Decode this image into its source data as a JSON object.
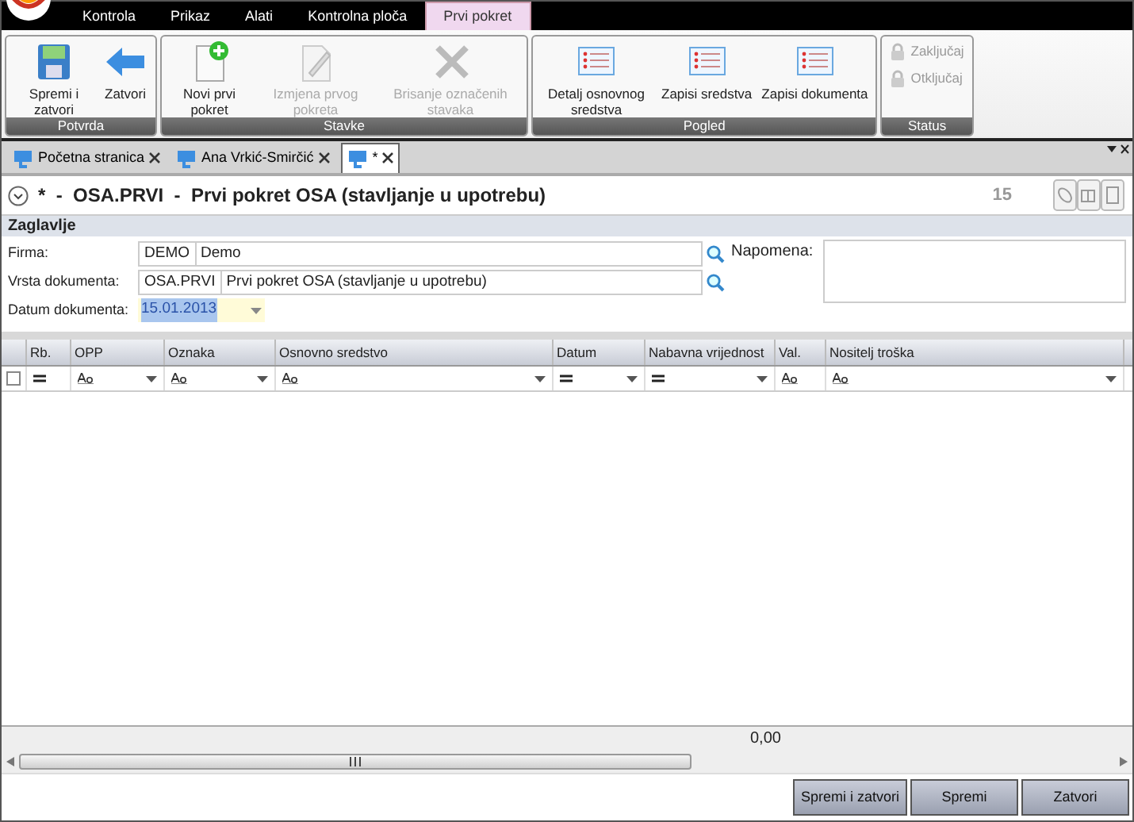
{
  "menu_tabs": [
    {
      "label": "Kontrola",
      "selected": false
    },
    {
      "label": "Prikaz",
      "selected": false
    },
    {
      "label": "Alati",
      "selected": false
    },
    {
      "label": "Kontrolna ploča",
      "selected": false
    },
    {
      "label": "Prvi pokret",
      "selected": true
    }
  ],
  "ribbon_groups": [
    {
      "title": "Potvrda",
      "kind": "large",
      "buttons": [
        {
          "label": "Spremi i zatvori",
          "kind": "save",
          "disabled": false
        },
        {
          "label": "Zatvori",
          "kind": "back",
          "disabled": false
        }
      ]
    },
    {
      "title": "Stavke",
      "kind": "large",
      "buttons": [
        {
          "label": "Novi prvi pokret",
          "kind": "new",
          "disabled": false
        },
        {
          "label": "Izmjena prvog pokreta",
          "kind": "edit",
          "disabled": true
        },
        {
          "label": "Brisanje označenih stavaka",
          "kind": "delete",
          "disabled": true
        }
      ]
    },
    {
      "title": "Pogled",
      "kind": "large",
      "buttons": [
        {
          "label": "Detalj osnovnog sredstva",
          "kind": "list",
          "disabled": false
        },
        {
          "label": "Zapisi sredstva",
          "kind": "list",
          "disabled": false
        },
        {
          "label": "Zapisi dokumenta",
          "kind": "list",
          "disabled": false
        }
      ]
    },
    {
      "title": "Status",
      "kind": "small",
      "buttons": [
        {
          "label": "Zaključaj",
          "kind": "lock",
          "disabled": true
        },
        {
          "label": "Otključaj",
          "kind": "lock",
          "disabled": true
        }
      ]
    }
  ],
  "doc_tabs": [
    {
      "label": "Početna stranica",
      "selected": false
    },
    {
      "label": "Ana Vrkić-Smirčić",
      "selected": false
    },
    {
      "label": "*",
      "selected": true
    }
  ],
  "document": {
    "title": "*  -  OSA.PRVI  -  Prvi pokret OSA (stavljanje u upotrebu)",
    "number": "15"
  },
  "section": {
    "title": "Zaglavlje"
  },
  "fields": [
    {
      "label": "Firma:",
      "code": "DEMO",
      "value": "Demo",
      "kind": "lookup"
    },
    {
      "label": "Vrsta dokumenta:",
      "code": "OSA.PRVI",
      "value": "Prvi pokret OSA (stavljanje u upotrebu)",
      "kind": "lookup"
    },
    {
      "label": "Datum dokumenta:",
      "value": "15.01.2013",
      "kind": "date"
    }
  ],
  "note": {
    "label": "Napomena:"
  },
  "table": {
    "columns": [
      {
        "label": "Rb.",
        "kind": "equals",
        "dropdown": false
      },
      {
        "label": "OPP",
        "kind": "text",
        "dropdown": true
      },
      {
        "label": "Oznaka",
        "kind": "text",
        "dropdown": true
      },
      {
        "label": "Osnovno sredstvo",
        "kind": "text",
        "dropdown": true
      },
      {
        "label": "Datum",
        "kind": "equals",
        "dropdown": true
      },
      {
        "label": "Nabavna vrijednost",
        "kind": "equals",
        "dropdown": true
      },
      {
        "label": "Val.",
        "kind": "text",
        "dropdown": false
      },
      {
        "label": "Nositelj troška",
        "kind": "text",
        "dropdown": true
      }
    ],
    "filter_checked": false,
    "total": "0,00"
  },
  "buttons": [
    "Spremi i zatvori",
    "Spremi",
    "Zatvori"
  ]
}
